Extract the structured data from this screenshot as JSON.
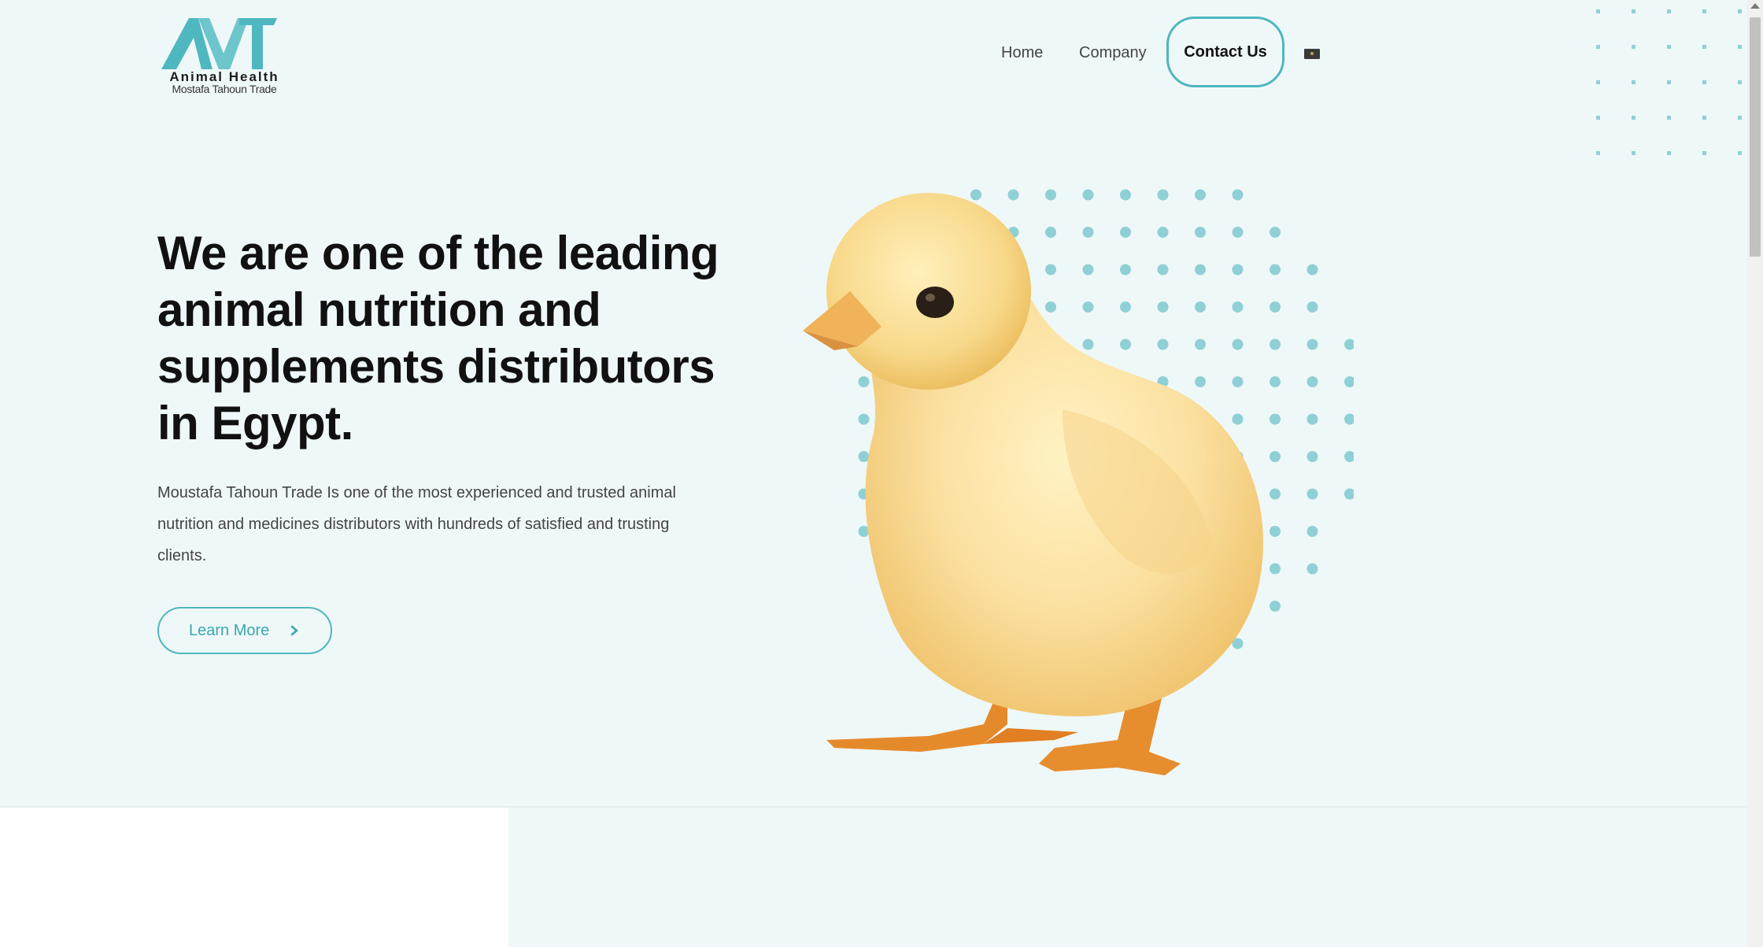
{
  "brand": {
    "logo_mark": "MT",
    "name": "Animal Health",
    "subtitle": "Mostafa Tahoun Trade"
  },
  "nav": {
    "home": "Home",
    "company": "Company",
    "contact": "Contact Us",
    "language_icon": "flag-icon"
  },
  "hero": {
    "headline": "We are one of the leading animal nutrition and supplements distributors in Egypt.",
    "description": "Moustafa Tahoun Trade Is one of the most experienced and trusted animal nutrition and medicines distributors with hundreds of satisfied and trusting clients.",
    "cta_label": "Learn More",
    "cta_icon": "chevron-right-icon"
  },
  "colors": {
    "accent": "#4fb7bf",
    "hero_bg": "#eff8f8",
    "dot": "#8fd0d6",
    "text": "#111111"
  }
}
